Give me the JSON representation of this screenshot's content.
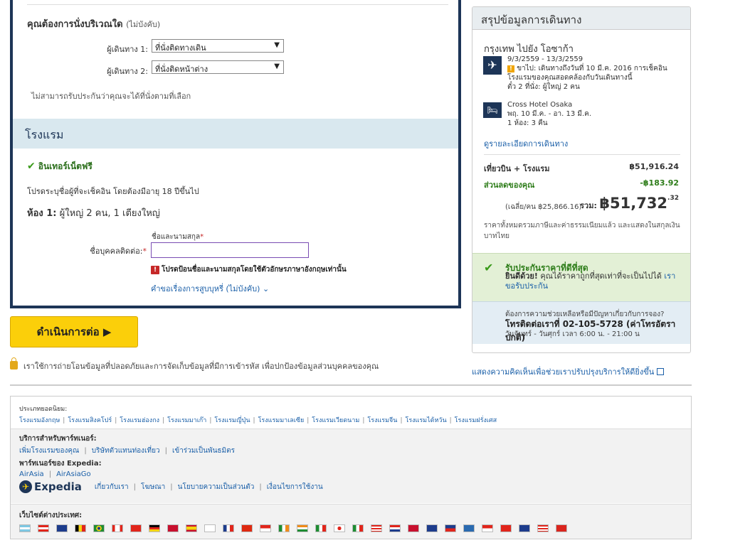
{
  "seating": {
    "question": "คุณต้องการนั่งบริเวณใด",
    "optional": "(ไม่บังคับ)",
    "passengers": [
      {
        "label": "ผู้เดินทาง 1:",
        "value": "ที่นั่งติดทางเดิน"
      },
      {
        "label": "ผู้เดินทาง 2:",
        "value": "ที่นั่งติดหน้าต่าง"
      }
    ],
    "note": "ไม่สามารถรับประกันว่าคุณจะได้ที่นั่งตามที่เลือก"
  },
  "hotel": {
    "heading": "โรงแรม",
    "amenity": "อินเทอร์เน็ตฟรี",
    "checkin_note": "โปรดระบุชื่อผู้ที่จะเช็คอิน โดยต้องมีอายุ 18 ปีขึ้นไป",
    "room_label": "ห้อง 1:",
    "room_detail": "ผู้ใหญ่ 2 คน, 1 เตียงใหญ่",
    "name_field_label": "ชื่อและนามสกุล",
    "contact_label": "ชื่อบุคคลติดต่อ:",
    "name_value": "",
    "error": "โปรดป้อนชื่อและนามสกุลโดยใช้ตัวอักษรภาษาอังกฤษเท่านั้น",
    "smoking_link": "คำขอเรื่องการสูบบุหรี่ (ไม่บังคับ) ⌄"
  },
  "actions": {
    "continue_label": "ดำเนินการต่อ ▶",
    "secure_text": "เราใช้การถ่ายโอนข้อมูลที่ปลอดภัยและการจัดเก็บข้อมูลที่มีการเข้ารหัส เพื่อปกป้องข้อมูลส่วนบุคคลของคุณ"
  },
  "summary": {
    "title": "สรุปข้อมูลการเดินทาง",
    "destination": "กรุงเทพ ไปยัง โอซาก้า",
    "flight": {
      "dates": "9/3/2559 - 13/3/2559",
      "warn_text": "ขาไป: เดินทางถึงวันที่ 10 มี.ค. 2016 การเช็คอิน",
      "warn_text2": "โรงแรมของคุณสอดคล้องกับวันเดินทางนี้",
      "tickets": "ตั๋ว 2 ที่นั่ง: ผู้ใหญ่ 2 คน"
    },
    "hotel": {
      "name": "Cross Hotel Osaka",
      "dates": "พฤ. 10 มี.ค. - อา. 13 มี.ค.",
      "rooms": "1 ห้อง: 3 คืน"
    },
    "trip_details_link": "ดูรายละเอียดการเดินทาง",
    "package_label": "เที่ยวบิน + โรงแรม",
    "package_price": "฿51,916.24",
    "discount_label": "ส่วนลดของคุณ",
    "discount_value": "-฿183.92",
    "per_person": "(เฉลี่ย/คน ฿25,866.16)",
    "total_label": "รวม:",
    "total_main": "฿51,732",
    "total_cents": ".32",
    "tax_note": "ราคาทั้งหมดรวมภาษีและค่าธรรมเนียมแล้ว และแสดงในสกุลเงิน บาทไทย",
    "guarantee_title": "รับประกันราคาที่ดีที่สุด",
    "guarantee_bold": "ยินดีด้วย!",
    "guarantee_text": " คุณได้ราคาถูกที่สุดเท่าที่จะเป็นไปได้ ",
    "guarantee_link": "เราขอรับประกัน",
    "help_question": "ต้องการความช่วยเหลือหรือมีปัญหาเกี่ยวกับการจอง?",
    "help_phone": "โทรติดต่อเราที่ 02-105-5728 (ค่าโทรอัตราปกติ)",
    "help_hours": "วันจันทร์ - วันศุกร์ เวลา 6:00 น. - 21:00 น"
  },
  "feedback_link": "แสดงความคิดเห็นเพื่อช่วยเราปรับปรุงบริการให้ดียิ่งขึ้น",
  "footer": {
    "popular_title": "ประเภทยอดนิยม:",
    "popular_links": [
      "โรงแรมอังกฤษ",
      "โรงแรมสิงคโปร์",
      "โรงแรมฮ่องกง",
      "โรงแรมมาเก๊า",
      "โรงแรมญี่ปุ่น",
      "โรงแรมมาเลเซีย",
      "โรงแรมเวียดนาม",
      "โรงแรมจีน",
      "โรงแรมไต้หวัน",
      "โรงแรมฝรั่งเศส"
    ],
    "partner_title": "บริการสำหรับพาร์ทเนอร์:",
    "partner_links": [
      "เพิ่มโรงแรมของคุณ",
      "บริษัทตัวแทนท่องเที่ยว",
      "เข้าร่วมเป็นพันธมิตร"
    ],
    "expedia_partners_title": "พาร์ทเนอร์ของ Expedia:",
    "expedia_partner_links": [
      "AirAsia",
      "AirAsiaGo"
    ],
    "logo_text": "Expedia",
    "company_links": [
      "เกี่ยวกับเรา",
      "โฆษณา",
      "นโยบายความเป็นส่วนตัว",
      "เงื่อนไขการใช้งาน"
    ],
    "intl_title": "เว็บไซต์ต่างประเทศ:"
  },
  "colors": {
    "navy": "#1d3557",
    "button_yellow": "#fbcf0a",
    "link_blue": "#1a5fa8",
    "success_green": "#2e7d1a"
  }
}
